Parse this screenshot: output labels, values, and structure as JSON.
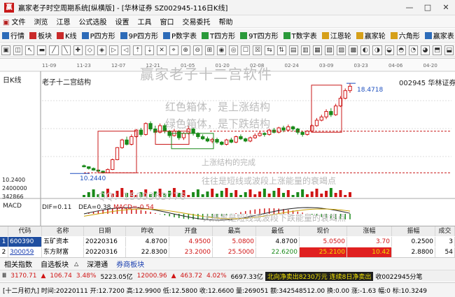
{
  "window": {
    "title": "赢家老子时空周期系统[纵横版] - [华林证券  SZ002945-116日K线]",
    "min_btn": "—",
    "max_btn": "□",
    "close_btn": "✕"
  },
  "menu": [
    "文件",
    "浏览",
    "江恩",
    "公式选股",
    "设置",
    "工具",
    "窗口",
    "交易委托",
    "帮助"
  ],
  "toolbar1": [
    "行情",
    "板块",
    "K线",
    "P四方形",
    "9P四方形",
    "P数字表",
    "T四方形",
    "9T四方形",
    "T数字表",
    "江恩轮",
    "赢家轮",
    "六角形",
    "赢家表"
  ],
  "toolbar2_count": 38,
  "chart": {
    "kline_label": "日K线",
    "chart_name": "老子十二宫结构",
    "stock": "002945  华林证券",
    "watermark": "赢家老子十二宫软件",
    "note_red": "红色箱体，是上涨结构",
    "note_green": "绿色箱体，是下跌结构",
    "note1": "上涨结构的完成",
    "note2": "往往是短线或波段上涨能量的衰竭点",
    "note3": "大概率是短线或波段下跌能量的衰竭点",
    "qq": "QQ：1509363776",
    "high_price": "18.4718",
    "low_price": "10.2440",
    "axis_left": [
      "10.2400",
      "2400000",
      "342866"
    ],
    "macd_label": "MACD",
    "dif": "DIF=0.11",
    "dea": "DEA=0.38",
    "macd": "MACD=-0.54",
    "date_ticks": [
      "11-09",
      "11-23",
      "12-07",
      "12-21",
      "01-05",
      "01-20",
      "02-08",
      "02-24",
      "03-09",
      "03-23",
      "04-06",
      "04-20"
    ],
    "colors": {
      "up": "#d01515",
      "down": "#1a8a1a",
      "box": "#c81818",
      "accent": "#1d4fbf"
    },
    "candles": [
      {
        "o": 10.95,
        "c": 10.85,
        "h": 11.05,
        "l": 10.8
      },
      {
        "o": 10.85,
        "c": 10.7,
        "h": 10.9,
        "l": 10.6
      },
      {
        "o": 10.7,
        "c": 10.55,
        "h": 10.78,
        "l": 10.5
      },
      {
        "o": 10.55,
        "c": 10.45,
        "h": 10.6,
        "l": 10.38
      },
      {
        "o": 10.45,
        "c": 10.3,
        "h": 10.5,
        "l": 10.24
      },
      {
        "o": 10.3,
        "c": 10.6,
        "h": 10.7,
        "l": 10.28
      },
      {
        "o": 10.6,
        "c": 11.5,
        "h": 11.6,
        "l": 10.55
      },
      {
        "o": 11.5,
        "c": 12.6,
        "h": 12.65,
        "l": 11.45
      },
      {
        "o": 12.6,
        "c": 13.3,
        "h": 13.4,
        "l": 12.5
      },
      {
        "o": 13.3,
        "c": 12.9,
        "h": 13.6,
        "l": 12.8
      },
      {
        "o": 12.9,
        "c": 13.6,
        "h": 13.8,
        "l": 12.8
      },
      {
        "o": 13.6,
        "c": 14.2,
        "h": 14.3,
        "l": 13.5
      },
      {
        "o": 14.2,
        "c": 13.8,
        "h": 14.4,
        "l": 13.6
      },
      {
        "o": 13.8,
        "c": 14.8,
        "h": 14.9,
        "l": 13.7
      },
      {
        "o": 14.8,
        "c": 14.3,
        "h": 15.0,
        "l": 14.1
      },
      {
        "o": 14.3,
        "c": 14.0,
        "h": 14.6,
        "l": 13.8
      },
      {
        "o": 14.0,
        "c": 14.6,
        "h": 14.8,
        "l": 13.9
      },
      {
        "o": 14.6,
        "c": 14.1,
        "h": 14.8,
        "l": 13.9
      },
      {
        "o": 14.1,
        "c": 13.7,
        "h": 14.2,
        "l": 13.5
      },
      {
        "o": 13.7,
        "c": 14.1,
        "h": 14.3,
        "l": 13.6
      },
      {
        "o": 14.1,
        "c": 13.5,
        "h": 14.2,
        "l": 13.3
      },
      {
        "o": 13.5,
        "c": 13.9,
        "h": 14.0,
        "l": 13.3
      },
      {
        "o": 13.9,
        "c": 14.3,
        "h": 14.6,
        "l": 13.8
      },
      {
        "o": 14.3,
        "c": 13.9,
        "h": 14.4,
        "l": 13.7
      },
      {
        "o": 13.9,
        "c": 13.6,
        "h": 14.0,
        "l": 13.4
      },
      {
        "o": 13.6,
        "c": 13.4,
        "h": 13.8,
        "l": 13.3
      },
      {
        "o": 13.4,
        "c": 13.2,
        "h": 13.6,
        "l": 13.1
      },
      {
        "o": 13.2,
        "c": 13.35,
        "h": 13.5,
        "l": 13.0
      },
      {
        "o": 13.35,
        "c": 13.1,
        "h": 13.5,
        "l": 12.95
      },
      {
        "o": 13.1,
        "c": 12.9,
        "h": 13.2,
        "l": 12.8
      },
      {
        "o": 12.9,
        "c": 13.3,
        "h": 13.4,
        "l": 12.8
      },
      {
        "o": 13.3,
        "c": 13.1,
        "h": 13.5,
        "l": 13.0
      },
      {
        "o": 13.1,
        "c": 13.6,
        "h": 13.7,
        "l": 13.0
      },
      {
        "o": 13.6,
        "c": 13.4,
        "h": 13.8,
        "l": 13.3
      },
      {
        "o": 13.4,
        "c": 13.2,
        "h": 13.5,
        "l": 13.1
      },
      {
        "o": 13.2,
        "c": 13.5,
        "h": 13.6,
        "l": 13.1
      },
      {
        "o": 13.5,
        "c": 13.7,
        "h": 13.9,
        "l": 13.4
      },
      {
        "o": 13.7,
        "c": 13.9,
        "h": 14.1,
        "l": 13.6
      },
      {
        "o": 13.9,
        "c": 13.8,
        "h": 14.0,
        "l": 13.6
      },
      {
        "o": 13.8,
        "c": 14.2,
        "h": 14.3,
        "l": 13.7
      },
      {
        "o": 14.2,
        "c": 14.0,
        "h": 14.4,
        "l": 13.9
      },
      {
        "o": 14.0,
        "c": 14.4,
        "h": 14.5,
        "l": 13.9
      },
      {
        "o": 14.4,
        "c": 14.2,
        "h": 14.6,
        "l": 14.0
      },
      {
        "o": 14.2,
        "c": 14.5,
        "h": 14.7,
        "l": 14.1
      },
      {
        "o": 14.5,
        "c": 14.3,
        "h": 14.6,
        "l": 14.1
      },
      {
        "o": 14.3,
        "c": 14.0,
        "h": 14.4,
        "l": 13.8
      },
      {
        "o": 14.0,
        "c": 13.8,
        "h": 14.1,
        "l": 13.6
      },
      {
        "o": 13.8,
        "c": 14.1,
        "h": 14.2,
        "l": 13.7
      },
      {
        "o": 14.1,
        "c": 14.6,
        "h": 14.7,
        "l": 14.0
      },
      {
        "o": 14.6,
        "c": 15.1,
        "h": 15.3,
        "l": 14.5
      },
      {
        "o": 15.1,
        "c": 15.4,
        "h": 15.6,
        "l": 15.0
      },
      {
        "o": 15.4,
        "c": 15.9,
        "h": 16.1,
        "l": 15.2
      },
      {
        "o": 15.9,
        "c": 15.6,
        "h": 16.2,
        "l": 15.4
      },
      {
        "o": 15.6,
        "c": 16.4,
        "h": 16.6,
        "l": 15.5
      },
      {
        "o": 16.4,
        "c": 17.1,
        "h": 17.3,
        "l": 16.3
      },
      {
        "o": 17.1,
        "c": 17.8,
        "h": 18.0,
        "l": 17.0
      },
      {
        "o": 17.8,
        "c": 18.2,
        "h": 18.47,
        "l": 17.6
      }
    ]
  },
  "table": {
    "headers": [
      "",
      "代码",
      "名称",
      "日期",
      "昨收",
      "开盘",
      "最高",
      "最低",
      "现价",
      "涨幅",
      "振幅",
      "成交"
    ],
    "rows": [
      {
        "idx": "1",
        "code": "600390",
        "name": "五矿资本",
        "date": "20220316",
        "prev": "4.8700",
        "open": "4.9500",
        "high": "5.0800",
        "low": "4.8700",
        "price": "5.0500",
        "chg": "3.70",
        "amp": "0.2500",
        "vol": "3"
      },
      {
        "idx": "2",
        "code": "300059",
        "name": "东方财富",
        "date": "20220316",
        "prev": "22.8300",
        "open": "23.2000",
        "high": "25.5000",
        "low": "22.6200",
        "price": "25.2100",
        "chg": "10.42",
        "amp": "2.8800",
        "vol": "54"
      }
    ]
  },
  "bottom_tabs": [
    "相关指数",
    "自选板块",
    "深港通",
    "券商板块"
  ],
  "tab_arrow": "△",
  "ticker": {
    "sh": "3170.71",
    "sh_arrow": "▲",
    "sh_chg": "106.74",
    "sh_pct": "3.48%",
    "sh_amt": "5223.05亿",
    "sz": "12000.96",
    "sz_arrow": "▲",
    "sz_chg": "463.72",
    "sz_pct": "4.02%",
    "sz_amt": "6697.33亿",
    "flow_box": "北向净卖出8230万元 连续8日净卖出",
    "index_icon": "Ⅲ",
    "qq_tail": "收0022945分笔"
  },
  "status": "[十二月初九] 时间:20220111 开:12.7200 高:12.9900 低:12.5800 收:12.6600 量:269051 额:342548512.00 换:0.00 涨:-1.63 幅:0 标:10.3249"
}
